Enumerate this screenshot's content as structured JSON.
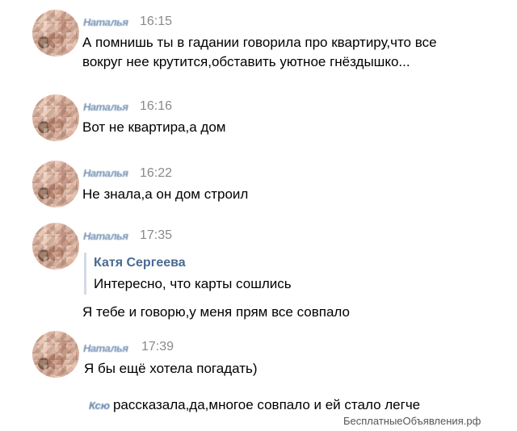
{
  "messages": [
    {
      "sender": "Наталья",
      "time": "16:15",
      "text_lines": [
        "А помнишь ты в гадании говорила про квартиру,что все",
        "вокруг нее крутится,обставить уютное гнёздышко..."
      ]
    },
    {
      "sender": "Наталья",
      "time": "16:16",
      "text_lines": [
        "Вот не квартира,а дом"
      ]
    },
    {
      "sender": "Наталья",
      "time": "16:22",
      "text_lines": [
        "Не знала,а он дом строил"
      ]
    },
    {
      "sender": "Наталья",
      "time": "17:35",
      "quote": {
        "author": "Катя Сергеева",
        "text": "Интересно, что карты сошлись"
      },
      "text_lines": [
        "Я тебе и говорю,у меня прям все совпало"
      ]
    },
    {
      "sender": "Наталья",
      "time": "17:39",
      "text_lines": [
        "Я бы ещё хотела погадать)"
      ]
    }
  ],
  "footer": {
    "blurred_prefix": "Ксю",
    "text": "рассказала,да,многое совпало и ей стало легче"
  },
  "watermark": "БесплатныеОбъявления.рф"
}
